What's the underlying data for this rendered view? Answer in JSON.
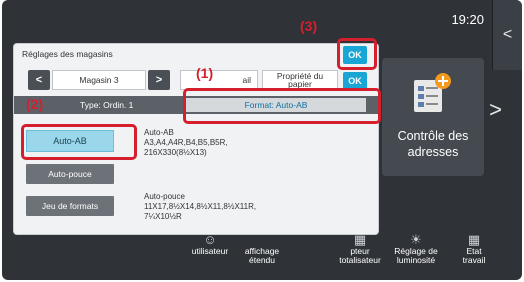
{
  "status": {
    "clock": "19:20"
  },
  "home": {
    "collapse_icon": "<",
    "next_icon": ">",
    "address_tile": {
      "label_line1": "Contrôle des",
      "label_line2": "adresses",
      "icon": "address-book-icon"
    },
    "bottom_items": [
      {
        "line1": "utilisateur",
        "line2": "",
        "line3": "",
        "icon": "user-icon"
      },
      {
        "line1": "affichage",
        "line2": "étendu",
        "line3": "",
        "icon": "display-icon"
      },
      {
        "line1": "pteur",
        "line2": "totalisateur",
        "line3": "",
        "icon": "counter-icon"
      },
      {
        "line1": "Réglage de",
        "line2": "luminosité",
        "line3": "",
        "icon": "brightness-icon"
      },
      {
        "line1": "Etat",
        "line2": "travail",
        "line3": "",
        "icon": "job-status-icon"
      }
    ]
  },
  "dialog": {
    "title": "Réglages des magasins",
    "ok_label": "OK",
    "prev_label": "<",
    "next_label": ">",
    "tray_tab": "Magasin 3",
    "tab_partial": "ail",
    "property_tab_line1": "Propriété du",
    "property_tab_line2": "papier",
    "type_label": "Type: Ordin. 1",
    "format_label": "Format: Auto-AB",
    "buttons": {
      "auto_ab": "Auto-AB",
      "auto_pouce": "Auto-pouce",
      "jeu_formats": "Jeu de formats"
    },
    "descriptions": {
      "auto_ab_title": "Auto-AB",
      "auto_ab_line1": "A3,A4,A4R,B4,B5,B5R,",
      "auto_ab_line2": "216X330(8½X13)",
      "auto_pouce_title": "Auto-pouce",
      "auto_pouce_line1": "11X17,8½X14,8½X11,8½X11R,",
      "auto_pouce_line2": "7¼X10½R"
    }
  },
  "callouts": {
    "c1": "(1)",
    "c2": "(2)",
    "c3": "(3)"
  },
  "colors": {
    "accent": "#1aa6d4",
    "callout": "#d51f2c",
    "selected": "#9bd7ea"
  }
}
